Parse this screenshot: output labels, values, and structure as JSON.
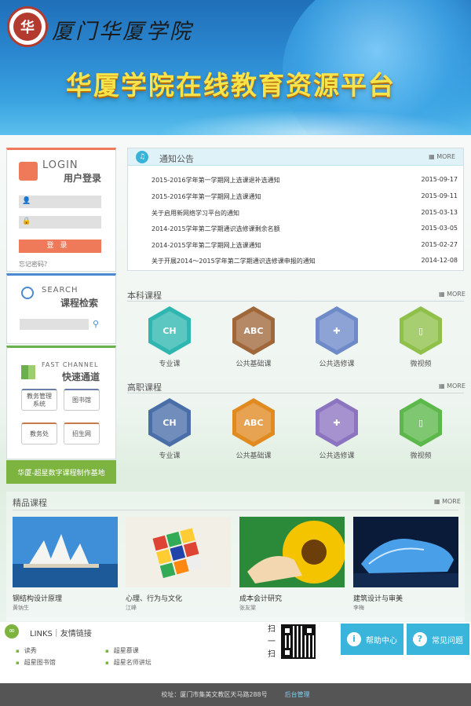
{
  "header": {
    "logo_text": "华",
    "school_name": "厦门华厦学院",
    "platform_title": "华厦学院在线教育资源平台"
  },
  "login": {
    "en_title": "LOGIN",
    "cn_title": "用户登录",
    "login_button": "登录",
    "forgot": "忘记密码？"
  },
  "search": {
    "en_title": "SEARCH",
    "cn_title": "课程检索"
  },
  "fast_channel": {
    "en_title": "FAST CHANNEL",
    "cn_title": "快速通道",
    "buttons": [
      "教务管理系统",
      "图书馆",
      "教务处",
      "招生网"
    ]
  },
  "banner_bar": "华厦-超星数字课程制作基地",
  "notice": {
    "title": "通知公告",
    "more": "MORE",
    "items": [
      {
        "title": "2015-2016学年第一学期网上选课退补选通知",
        "date": "2015-09-17"
      },
      {
        "title": "2015-2016学年第一学期网上选课通知",
        "date": "2015-09-11"
      },
      {
        "title": "关于启用新网络学习平台的通知",
        "date": "2015-03-13"
      },
      {
        "title": "2014-2015学年第二学期通识选修课剩余名额",
        "date": "2015-03-05"
      },
      {
        "title": "2014-2015学年第二学期网上选课通知",
        "date": "2015-02-27"
      },
      {
        "title": "关于开展2014～2015学年第二学期通识选修课申报的通知",
        "date": "2014-12-08"
      }
    ]
  },
  "undergrad": {
    "title": "本科课程",
    "more": "MORE",
    "items": [
      {
        "label": "专业课",
        "glyph": "CH",
        "color": "#2fb6b0",
        "icon": "chemistry-icon"
      },
      {
        "label": "公共基础课",
        "glyph": "ABC",
        "color": "#a0683a",
        "icon": "abc-blocks-icon"
      },
      {
        "label": "公共选修课",
        "glyph": "✚",
        "color": "#6f8ac9",
        "icon": "puzzle-icon"
      },
      {
        "label": "微视频",
        "glyph": "▯",
        "color": "#8fc04a",
        "icon": "phone-icon"
      }
    ]
  },
  "vocational": {
    "title": "高职课程",
    "more": "MORE",
    "items": [
      {
        "label": "专业课",
        "glyph": "CH",
        "color": "#4a6ea8",
        "icon": "chemistry-icon"
      },
      {
        "label": "公共基础课",
        "glyph": "ABC",
        "color": "#e08a20",
        "icon": "abc-blocks-icon"
      },
      {
        "label": "公共选修课",
        "glyph": "✚",
        "color": "#8c74c0",
        "icon": "puzzle-icon"
      },
      {
        "label": "微视频",
        "glyph": "▯",
        "color": "#5cb84a",
        "icon": "phone-icon"
      }
    ]
  },
  "featured": {
    "title": "精品课程",
    "more": "MORE",
    "items": [
      {
        "title": "钢结构设计原理",
        "author": "黄钠生"
      },
      {
        "title": "心理、行为与文化",
        "author": "江峰"
      },
      {
        "title": "成本会计研究",
        "author": "张友棠"
      },
      {
        "title": "建筑设计与审美",
        "author": "李梅"
      }
    ]
  },
  "links": {
    "title": "LINKS｜友情链接",
    "items": [
      "读秀",
      "超星慕课",
      "超星图书馆",
      "超星名师讲坛"
    ],
    "scan": "扫一扫",
    "help_center": "帮助中心",
    "faq": "常见问题"
  },
  "footer": {
    "address": "校址：厦门市集美文教区天马路288号",
    "admin": "后台管理"
  }
}
